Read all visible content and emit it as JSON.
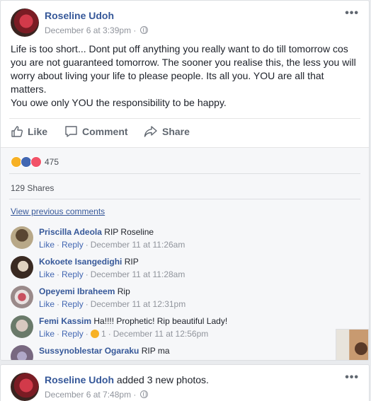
{
  "post1": {
    "author": "Roseline Udoh",
    "timestamp": "December 6 at 3:39pm",
    "privacy_separator": "·",
    "privacy_icon": "globe-icon",
    "more_label": "•••",
    "text_lines": [
      "Life is too short... Dont put off anything you really want to do till tomorrow cos",
      "you are not guaranteed tomorrow. The sooner you realise this, the less you will",
      "worry about living your life to please people. Its all you. YOU are all that",
      "matters.",
      "You owe only YOU the responsibility to be happy."
    ],
    "actions": {
      "like": "Like",
      "comment": "Comment",
      "share": "Share"
    },
    "reactions": {
      "icons": [
        "sad-reaction-icon",
        "like-reaction-icon",
        "love-reaction-icon"
      ],
      "count": "475"
    },
    "shares": "129 Shares",
    "view_previous": "View previous comments",
    "comments": [
      {
        "name": "Priscilla Adeola",
        "text": "RIP Roseline",
        "like": "Like",
        "reply": "Reply",
        "time": "December 11 at 11:26am",
        "reaction_count": ""
      },
      {
        "name": "Kokoete Isangedighi",
        "text": "RIP",
        "like": "Like",
        "reply": "Reply",
        "time": "December 11 at 11:28am",
        "reaction_count": ""
      },
      {
        "name": "Opeyemi Ibraheem",
        "text": "Rip",
        "like": "Like",
        "reply": "Reply",
        "time": "December 11 at 12:31pm",
        "reaction_count": ""
      },
      {
        "name": "Femi Kassim",
        "text": "Ha!!!! Prophetic! Rip beautiful Lady!",
        "like": "Like",
        "reply": "Reply",
        "time": "December 11 at 12:56pm",
        "reaction_count": "1"
      },
      {
        "name": "Sussynoblestar Ogaraku",
        "text": "RIP ma"
      }
    ]
  },
  "post2": {
    "author": "Roseline Udoh",
    "action_text": " added ",
    "count": "3",
    "action_suffix": " new photos.",
    "timestamp": "December 6 at 7:48pm",
    "privacy_separator": "·",
    "more_label": "•••"
  },
  "colors": {
    "link": "#365899",
    "meta": "#90949c",
    "background": "#e9ebee",
    "like_blue": "#4267b2"
  }
}
